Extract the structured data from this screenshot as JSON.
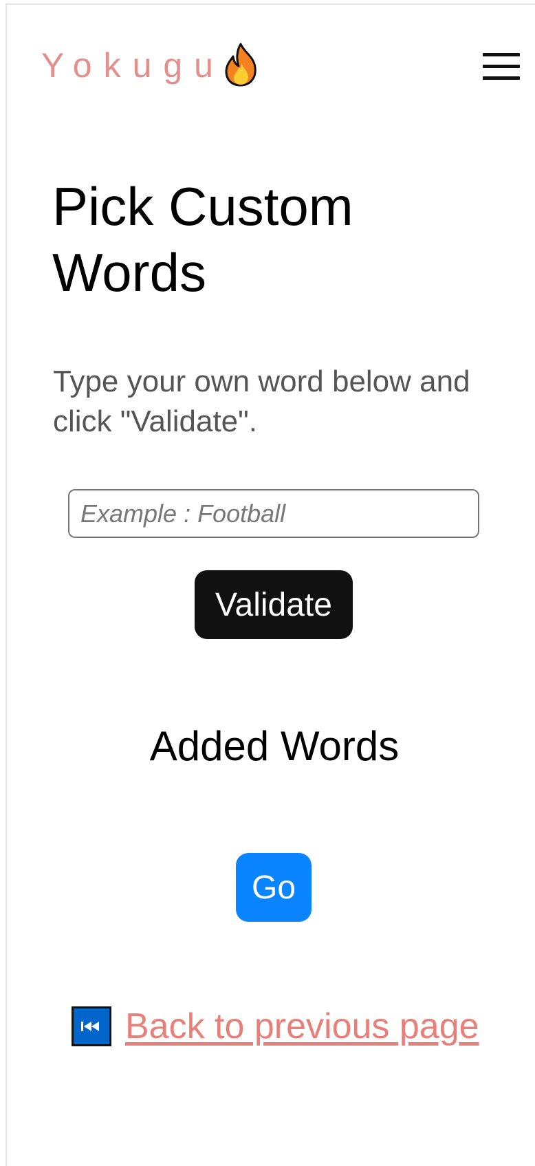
{
  "header": {
    "brand": "Yokugu",
    "brand_icon": "fire-icon",
    "menu_icon": "hamburger-menu-icon"
  },
  "main": {
    "title": "Pick Custom Words",
    "instructions": "Type your own word below and click \"Validate\".",
    "word_input": {
      "value": "",
      "placeholder": "Example : Football"
    },
    "validate_label": "Validate",
    "added_words_title": "Added Words",
    "added_words": [],
    "go_label": "Go",
    "back_link": {
      "icon": "rewind-icon",
      "label": "Back to previous page"
    }
  },
  "colors": {
    "brand": "#e3908c",
    "validate_button": "#111111",
    "go_button": "#0a84ff",
    "back_link": "#e8807a",
    "rewind_icon": "#0066cc"
  }
}
